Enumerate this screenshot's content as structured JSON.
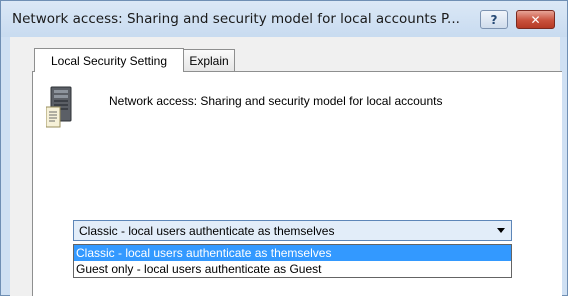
{
  "window": {
    "title": "Network access: Sharing and security model for local accounts P...",
    "help_label": "?",
    "close_label": "✕"
  },
  "tabs": [
    {
      "label": "Local Security Setting",
      "active": true
    },
    {
      "label": "Explain",
      "active": false
    }
  ],
  "policy": {
    "icon": "server-icon",
    "name": "Network access: Sharing and security model for local accounts"
  },
  "combo": {
    "selected": "Classic - local users authenticate as themselves",
    "options": [
      "Classic - local users authenticate as themselves",
      "Guest only - local users authenticate as Guest"
    ],
    "highlight_color": "#3399ff"
  }
}
